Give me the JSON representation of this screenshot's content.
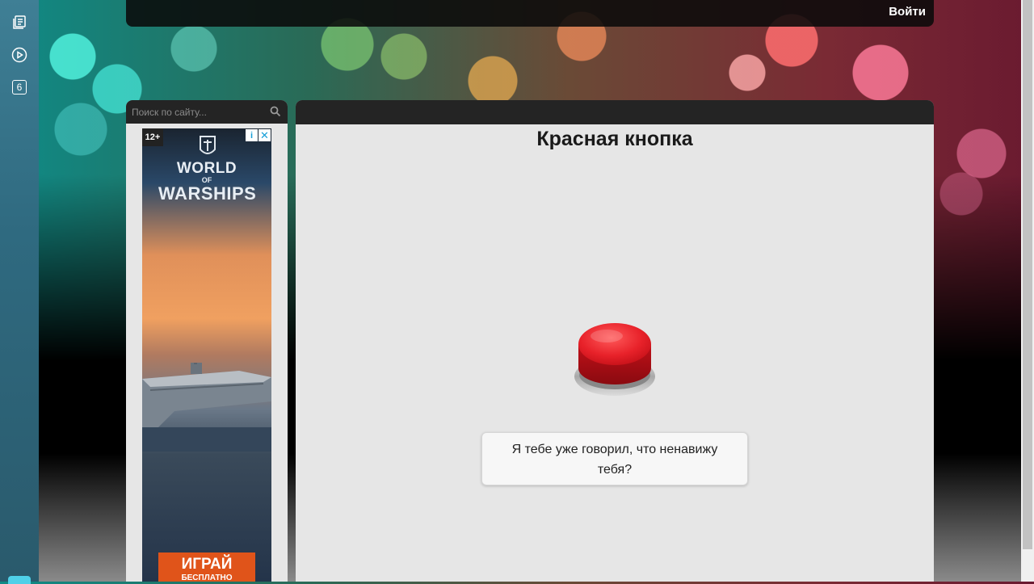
{
  "header": {
    "login_label": "Войти"
  },
  "left_rail": {
    "icons": [
      "news-icon",
      "play-icon"
    ],
    "badge_count": "6"
  },
  "sidebar": {
    "search": {
      "placeholder": "Поиск по сайту...",
      "value": ""
    },
    "ad": {
      "age_rating": "12+",
      "logo_line1": "WORLD",
      "logo_line2": "OF",
      "logo_line3": "WARSHIPS",
      "cta_main": "ИГРАЙ",
      "cta_sub": "БЕСПЛАТНО"
    }
  },
  "main": {
    "title": "Красная кнопка",
    "message": "Я тебе уже говорил, что ненавижу тебя?"
  },
  "colors": {
    "button_red": "#e0212a",
    "panel_bg": "#e6e6e6",
    "bar_dark": "#141414",
    "rail": "#2f6a80",
    "ad_cta": "#e0541a"
  }
}
